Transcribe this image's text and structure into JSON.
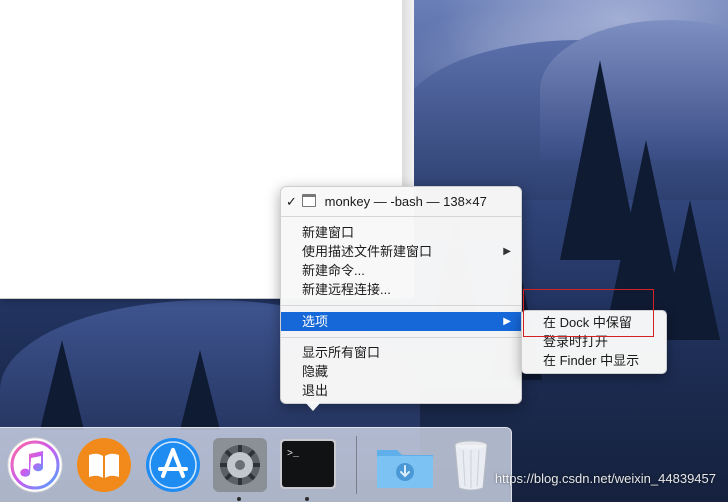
{
  "context_menu": {
    "window_item": "monkey — -bash — 138×47",
    "checkmark": "✓",
    "items": [
      "新建窗口",
      "使用描述文件新建窗口",
      "新建命令...",
      "新建远程连接...",
      "选项",
      "显示所有窗口",
      "隐藏",
      "退出"
    ],
    "submenu_arrow": "▶"
  },
  "options_submenu": {
    "items": [
      "在 Dock 中保留",
      "登录时打开",
      "在 Finder 中显示"
    ]
  },
  "dock": {
    "apps": [
      "music-icon",
      "books-icon",
      "app-store-icon",
      "system-preferences-icon",
      "terminal-icon",
      "downloads-folder-icon",
      "trash-icon"
    ]
  },
  "watermark": "https://blog.csdn.net/weixin_44839457",
  "colors": {
    "menu_highlight": "#1667d8",
    "annotation_box": "#d22222"
  }
}
